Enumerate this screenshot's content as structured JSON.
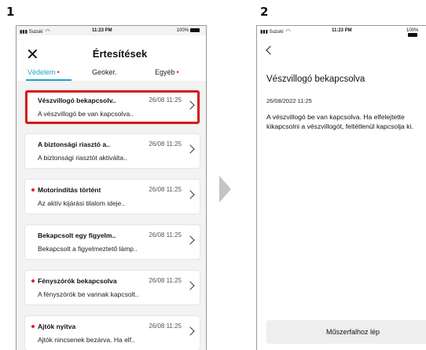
{
  "steps": {
    "step1": "1",
    "step2": "2"
  },
  "statusbar": {
    "carrier": "Suzuki",
    "time": "11:23 PM",
    "battery": "100%"
  },
  "screen1": {
    "title": "Értesítések",
    "tabs": [
      {
        "label": "Védelem",
        "dot": "•"
      },
      {
        "label": "Geoker."
      },
      {
        "label": "Egyéb",
        "dot": "•"
      }
    ],
    "items": [
      {
        "title": "Vészvillogó bekapcsolv..",
        "date": "26/08 11:25",
        "body": "A vészvillogó be van kapcsolva.."
      },
      {
        "title": "A biztonsági riasztó a..",
        "date": "26/08 11:25",
        "body": "A biztonsági riasztót aktiválta.."
      },
      {
        "title": "Motorindítás történt",
        "date": "26/08 11:25",
        "body": "Az aktív kijárási tilalom ideje.."
      },
      {
        "title": "Bekapcsolt egy figyelm..",
        "date": "26/08 11:25",
        "body": "Bekapcsolt a figyelmeztető lámp.."
      },
      {
        "title": "Fényszórók bekapcsolva",
        "date": "26/08 11:25",
        "body": "A fényszórók be vannak kapcsolt.."
      },
      {
        "title": "Ajtók nyitva",
        "date": "26/08 11:25",
        "body": "Ajtók nincsenek bezárva. Ha elf.."
      }
    ]
  },
  "screen2": {
    "title": "Vészvillogó bekapcsolva",
    "date": "26/08/2022 11:25",
    "body": "A vészvillogó be van kapcsolva. Ha elfelejtette kikapcsolni a vészvillogót, feltétlenül kapcsolja ki.",
    "button": "Műszerfalhoz lép"
  },
  "colors": {
    "accent": "#1ea2c9",
    "highlight": "#d71920",
    "unread": "#e0202f"
  }
}
